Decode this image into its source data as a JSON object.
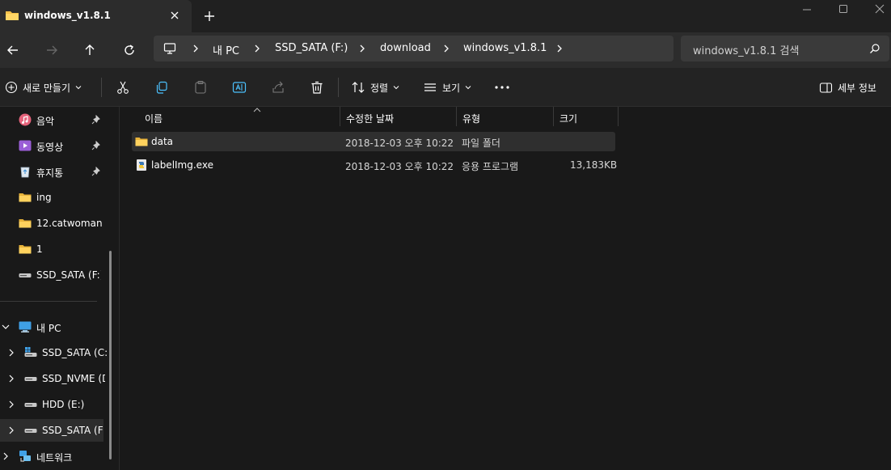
{
  "window": {
    "tab_title": "windows_v1.8.1"
  },
  "nav": {
    "breadcrumbs": [
      "내 PC",
      "SSD_SATA (F:)",
      "download",
      "windows_v1.8.1"
    ],
    "search_placeholder": "windows_v1.8.1 검색"
  },
  "toolbar": {
    "new_label": "새로 만들기",
    "sort_label": "정렬",
    "view_label": "보기",
    "details_label": "세부 정보"
  },
  "sidebar": {
    "quick": [
      {
        "label": "음악",
        "icon": "music-icon",
        "pinned": true
      },
      {
        "label": "동영상",
        "icon": "video-icon",
        "pinned": true
      },
      {
        "label": "휴지통",
        "icon": "recycle-bin-icon",
        "pinned": true
      },
      {
        "label": "ing",
        "icon": "folder-icon",
        "pinned": false
      },
      {
        "label": "12.catwoman",
        "icon": "folder-icon",
        "pinned": false
      },
      {
        "label": "1",
        "icon": "folder-icon",
        "pinned": false
      },
      {
        "label": "SSD_SATA (F:)",
        "icon": "drive-icon",
        "pinned": false
      }
    ],
    "this_pc": {
      "label": "내 PC",
      "icon": "computer-icon"
    },
    "drives": [
      {
        "label": "SSD_SATA (C:",
        "icon": "system-drive-icon"
      },
      {
        "label": "SSD_NVME (D",
        "icon": "drive-icon"
      },
      {
        "label": "HDD (E:)",
        "icon": "drive-icon"
      },
      {
        "label": "SSD_SATA (F:)",
        "icon": "drive-icon"
      }
    ],
    "network": {
      "label": "네트워크",
      "icon": "network-icon"
    }
  },
  "columns": {
    "name": "이름",
    "modified": "수정한 날짜",
    "type": "유형",
    "size": "크기"
  },
  "files": [
    {
      "name": "data",
      "modified": "2018-12-03 오후 10:22",
      "type": "파일 폴더",
      "size": "",
      "icon": "folder-icon"
    },
    {
      "name": "labelImg.exe",
      "modified": "2018-12-03 오후 10:22",
      "type": "응용 프로그램",
      "size": "13,183KB",
      "icon": "python-exe-icon"
    }
  ],
  "colors": {
    "background": "#191919",
    "folder": "#f4c04a",
    "accent": "#4cc2ff"
  }
}
